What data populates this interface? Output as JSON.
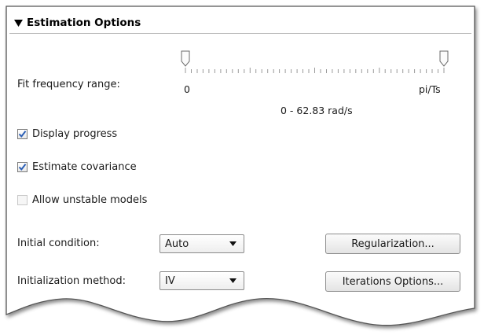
{
  "section": {
    "title": "Estimation Options",
    "icon": "triangle-down-icon"
  },
  "fit_range": {
    "label": "Fit frequency range:",
    "min_label": "0",
    "max_label": "pi/Ts",
    "readout": "0 - 62.83 rad/s",
    "low_fraction": 0,
    "high_fraction": 1
  },
  "options": {
    "display_progress": {
      "label": "Display progress",
      "checked": true
    },
    "estimate_covariance": {
      "label": "Estimate covariance",
      "checked": true
    },
    "allow_unstable": {
      "label": "Allow unstable models",
      "checked": false,
      "enabled": false
    }
  },
  "initial_condition": {
    "label": "Initial condition:",
    "value": "Auto"
  },
  "init_method": {
    "label": "Initialization method:",
    "value": "IV"
  },
  "buttons": {
    "regularization": "Regularization...",
    "iterations": "Iterations Options..."
  },
  "colors": {
    "check": "#2b5fb5",
    "panel_border": "#555555"
  }
}
